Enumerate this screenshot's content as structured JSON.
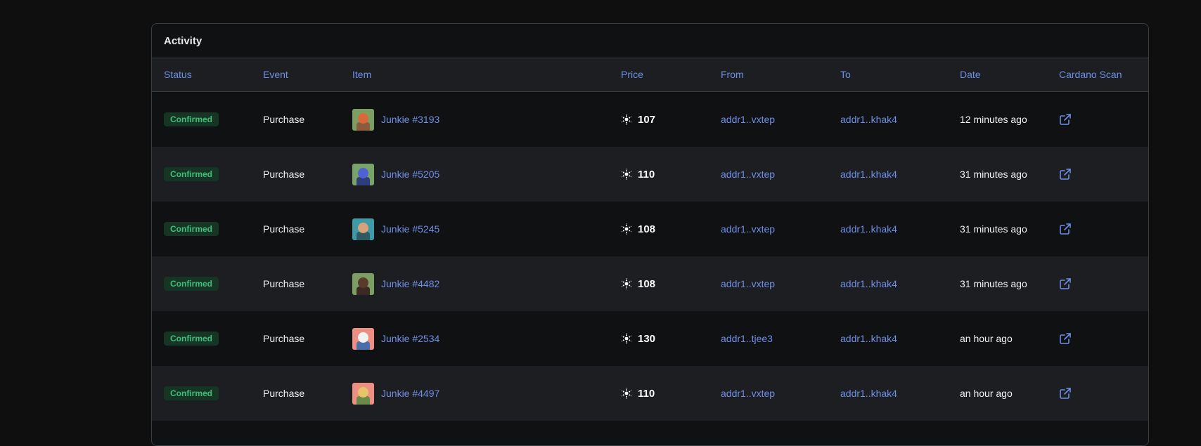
{
  "panel": {
    "title": "Activity"
  },
  "columns": [
    "Status",
    "Event",
    "Item",
    "Price",
    "From",
    "To",
    "Date",
    "Cardano Scan"
  ],
  "rows": [
    {
      "status": "Confirmed",
      "event": "Purchase",
      "item": "Junkie #3193",
      "price": "107",
      "from": "addr1..vxtep",
      "to": "addr1..khak4",
      "date": "12 minutes ago",
      "thumb_bg": "#7d9e63",
      "thumb_head": "#d86a3a",
      "thumb_body": "#8c5a3c"
    },
    {
      "status": "Confirmed",
      "event": "Purchase",
      "item": "Junkie #5205",
      "price": "110",
      "from": "addr1..vxtep",
      "to": "addr1..khak4",
      "date": "31 minutes ago",
      "thumb_bg": "#7aa36a",
      "thumb_head": "#4e62d6",
      "thumb_body": "#2f3e7a"
    },
    {
      "status": "Confirmed",
      "event": "Purchase",
      "item": "Junkie #5245",
      "price": "108",
      "from": "addr1..vxtep",
      "to": "addr1..khak4",
      "date": "31 minutes ago",
      "thumb_bg": "#3d9aa6",
      "thumb_head": "#d9a27a",
      "thumb_body": "#2f5a62"
    },
    {
      "status": "Confirmed",
      "event": "Purchase",
      "item": "Junkie #4482",
      "price": "108",
      "from": "addr1..vxtep",
      "to": "addr1..khak4",
      "date": "31 minutes ago",
      "thumb_bg": "#7d9e63",
      "thumb_head": "#5a3a2a",
      "thumb_body": "#3b2a22"
    },
    {
      "status": "Confirmed",
      "event": "Purchase",
      "item": "Junkie #2534",
      "price": "130",
      "from": "addr1..tjee3",
      "to": "addr1..khak4",
      "date": "an hour ago",
      "thumb_bg": "#ee8f84",
      "thumb_head": "#f2f2f2",
      "thumb_body": "#4a6fa8"
    },
    {
      "status": "Confirmed",
      "event": "Purchase",
      "item": "Junkie #4497",
      "price": "110",
      "from": "addr1..vxtep",
      "to": "addr1..khak4",
      "date": "an hour ago",
      "thumb_bg": "#ee8f84",
      "thumb_head": "#e7c36a",
      "thumb_body": "#6b8a4a"
    }
  ],
  "icons": {
    "price": "ada-icon",
    "scan": "external-link-icon"
  },
  "colors": {
    "accent": "#6f8fe8",
    "confirmed_bg": "#173524",
    "confirmed_text": "#3ec07a"
  }
}
